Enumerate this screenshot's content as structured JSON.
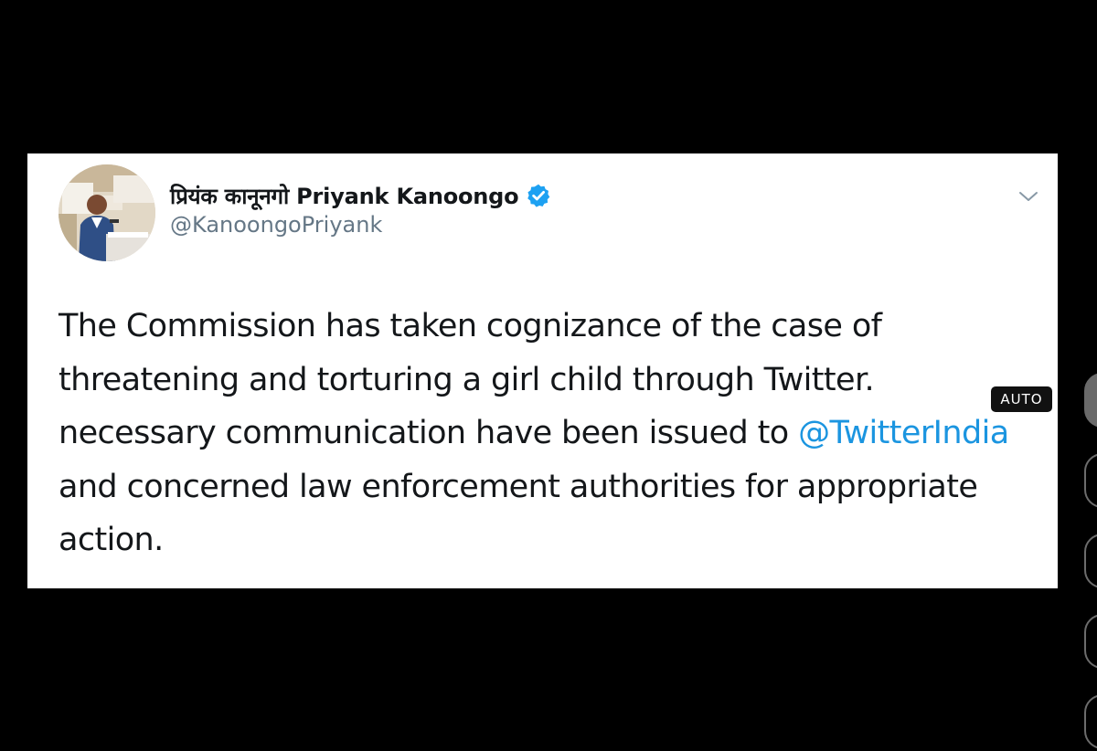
{
  "tweet": {
    "display_name": "प्रियंक कानूनगो Priyank Kanoongo",
    "handle": "@KanoongoPriyank",
    "verified": true,
    "body_lines": {
      "l1": "The Commission has taken cognizance of the case of",
      "l2": "threatening and torturing a girl child through Twitter.",
      "l3_text": "necessary communication have been issued to ",
      "l3_mention": "@TwitterIndia",
      "l4": "and concerned law enforcement authorities for appropriate",
      "l5": "action."
    },
    "mention_color": "#1b95e0",
    "verified_color": "#1da1f2"
  },
  "overlay": {
    "auto_badge": "AUTO"
  },
  "icons": {
    "verified": "verified-badge-icon",
    "caret": "chevron-down-icon"
  }
}
